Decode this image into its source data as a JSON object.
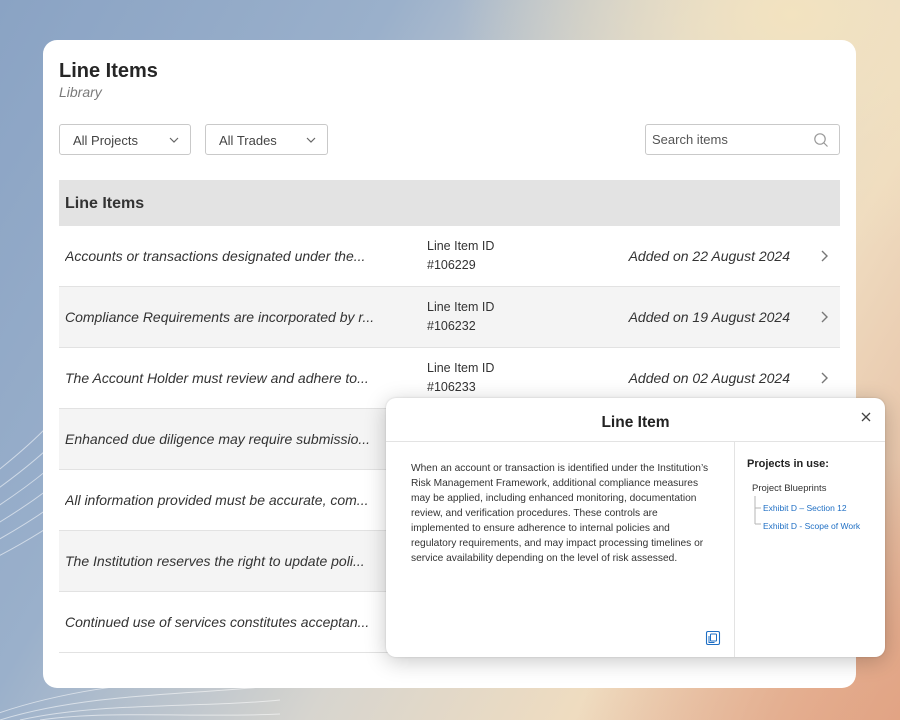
{
  "page": {
    "title": "Line Items",
    "subtitle": "Library"
  },
  "filters": {
    "projects": "All Projects",
    "trades": "All Trades"
  },
  "search": {
    "placeholder": "Search items"
  },
  "table": {
    "header": "Line Items",
    "rows": [
      {
        "desc": "Accounts or transactions designated under the...",
        "id_label": "Line Item ID",
        "id": "#106229",
        "date": "Added on 22 August 2024"
      },
      {
        "desc": "Compliance Requirements are incorporated by r...",
        "id_label": "Line Item ID",
        "id": "#106232",
        "date": "Added on 19 August 2024"
      },
      {
        "desc": "The Account Holder must review and adhere to...",
        "id_label": "Line Item ID",
        "id": "#106233",
        "date": "Added on 02 August 2024"
      },
      {
        "desc": "Enhanced due diligence may require submissio...",
        "id_label": "",
        "id": "",
        "date": ""
      },
      {
        "desc": "All information provided must be accurate, com...",
        "id_label": "",
        "id": "",
        "date": ""
      },
      {
        "desc": "The Institution reserves the right to update poli...",
        "id_label": "",
        "id": "",
        "date": ""
      },
      {
        "desc": "Continued use of services constitutes acceptan...",
        "id_label": "",
        "id": "",
        "date": ""
      }
    ]
  },
  "modal": {
    "title": "Line Item",
    "body": "When an account or transaction is identified under the Institution’s Risk Management Framework, additional compliance measures may be applied, including enhanced monitoring, documentation review, and verification procedures. These controls are implemented to ensure adherence to internal policies and regulatory requirements, and may impact processing timelines or service availability depending on the level of risk assessed.",
    "projects_heading": "Projects in use:",
    "project_name": "Project Blueprints",
    "links": [
      "Exhibit D – Section 12",
      "Exhibit D - Scope of Work"
    ]
  },
  "colors": {
    "accent": "#1f6fc4",
    "header_bg": "#e3e3e3",
    "alt_row": "#f4f4f4"
  },
  "icons": {
    "dropdown": "chevron-down-icon",
    "search": "search-icon",
    "row_open": "chevron-right-icon",
    "close": "close-icon",
    "copy": "copy-icon"
  }
}
